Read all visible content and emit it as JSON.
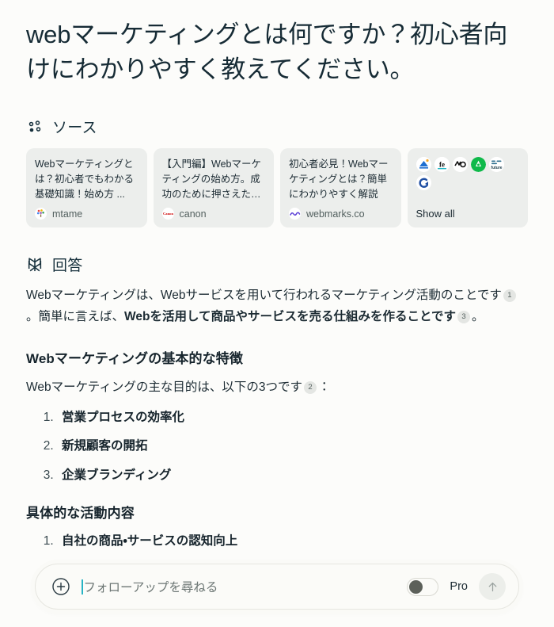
{
  "query": {
    "title": "webマーケティングとは何ですか？初心者向けにわかりやすく教えてください。"
  },
  "sources": {
    "icon": "sources-dots-icon",
    "label": "ソース",
    "cards": [
      {
        "title": "Webマーケティングとは？初心者でもわかる基礎知識！始め方 ...",
        "site": "mtame",
        "favicon": "mtame-favicon"
      },
      {
        "title": "【入門編】Webマーケティングの始め方。成功のために押さえたい ...",
        "site": "canon",
        "favicon": "canon-favicon"
      },
      {
        "title": "初心者必見！Webマーケティングとは？簡単にわかりやすく解説",
        "site": "webmarks.co",
        "favicon": "webmarks-favicon"
      }
    ],
    "show_all": {
      "label": "Show all",
      "favicons": [
        "archive-blue-favicon",
        "fe-favicon",
        "mo-favicon",
        "green-circle-favicon",
        "cloud-favicon",
        "e-blue-favicon"
      ]
    }
  },
  "answer": {
    "icon": "perplexity-logo-icon",
    "label": "回答",
    "paragraph": {
      "lead": "Webマーケティングは、Webサービスを用いて行われるマーケティング活動のことです",
      "cite_1": "1",
      "middle": "。簡単に言えば、",
      "bold": "Webを活用して商品やサービスを売る仕組みを作ることです",
      "cite_2": "3",
      "tail": "。"
    },
    "subheading": "Webマーケティングの基本的な特徴",
    "intro": {
      "text": "Webマーケティングの主な目的は、以下の3つです",
      "cite": "2",
      "tail": "："
    },
    "list": [
      "営業プロセスの効率化",
      "新規顧客の開拓",
      "企業ブランディング"
    ],
    "next_heading": "具体的な活動内容",
    "clipped_item": "自社の商品・サービスの認知向上"
  },
  "composer": {
    "plus_icon": "plus-circle-icon",
    "placeholder": "フォローアップを尋ねる",
    "value": "",
    "pro_label": "Pro",
    "pro_enabled": false,
    "submit_icon": "arrow-up-icon"
  },
  "colors": {
    "background": "#fcfcfa",
    "text": "#1c2b33",
    "card_bg": "#eceeec",
    "citation_bg": "#e4e6e3",
    "caret": "#27b3c4",
    "toggle_knob": "#5c605a"
  }
}
